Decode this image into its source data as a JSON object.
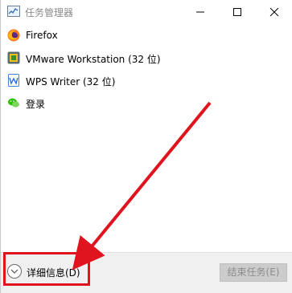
{
  "window": {
    "title": "任务管理器",
    "icon": "task-manager-icon"
  },
  "titlebar_buttons": [
    {
      "name": "minimize",
      "icon": "minimize-icon"
    },
    {
      "name": "maximize",
      "icon": "maximize-icon"
    },
    {
      "name": "close",
      "icon": "close-icon"
    }
  ],
  "apps": [
    {
      "label": "Firefox",
      "icon": "firefox-icon"
    },
    {
      "label": "VMware Workstation (32 位)",
      "icon": "vmware-icon"
    },
    {
      "label": "WPS Writer (32 位)",
      "icon": "wps-writer-icon"
    },
    {
      "label": "登录",
      "icon": "wechat-icon"
    }
  ],
  "footer": {
    "details_label": "详细信息(D)",
    "end_task_label": "结束任务(E)"
  },
  "colors": {
    "annotation": "#e0141e",
    "bottom_bar": "#f0f0f0",
    "disabled_button": "#cccccc"
  }
}
